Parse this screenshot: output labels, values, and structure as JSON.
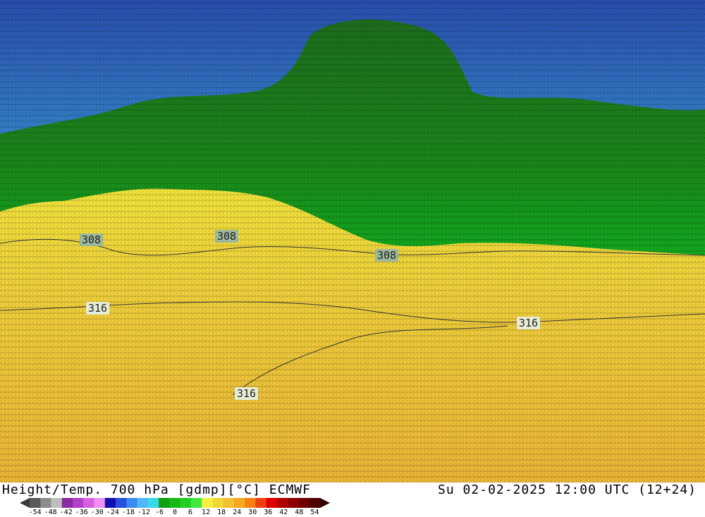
{
  "map": {
    "contour_labels": [
      {
        "value": "308",
        "level": "308"
      },
      {
        "value": "308",
        "level": "308"
      },
      {
        "value": "308",
        "level": "308"
      },
      {
        "value": "316",
        "level": "316"
      },
      {
        "value": "316",
        "level": "316"
      },
      {
        "value": "316",
        "level": "316"
      }
    ],
    "colors": {
      "deep_blue": "#2a4fb0",
      "cyan": "#33c8e0",
      "dark_green": "#1e7a1e",
      "green": "#10b020",
      "bright_green": "#22dd22",
      "yellow": "#f2e23a",
      "orange_yellow": "#f0c038"
    }
  },
  "footer": {
    "title": "Height/Temp. 700 hPa [gdmp][°C] ECMWF",
    "datetime": "Su 02-02-2025 12:00 UTC (12+24)"
  },
  "legend": {
    "ticks": [
      "-54",
      "-48",
      "-42",
      "-36",
      "-30",
      "-24",
      "-18",
      "-12",
      "-6",
      "0",
      "6",
      "12",
      "18",
      "24",
      "30",
      "36",
      "42",
      "48",
      "54"
    ],
    "colors": [
      "#5a5a5a",
      "#8c8c8c",
      "#bebebe",
      "#8a2aa0",
      "#b040c8",
      "#d860e0",
      "#f090f0",
      "#1010b0",
      "#2850e0",
      "#3c8cf0",
      "#50b8f8",
      "#38d8e8",
      "#10a010",
      "#18b818",
      "#20d020",
      "#40e840",
      "#f8f040",
      "#f0d838",
      "#f0c030",
      "#f8a820",
      "#f88010",
      "#f04010",
      "#e00000",
      "#b00000",
      "#900000",
      "#700000",
      "#500000"
    ]
  }
}
